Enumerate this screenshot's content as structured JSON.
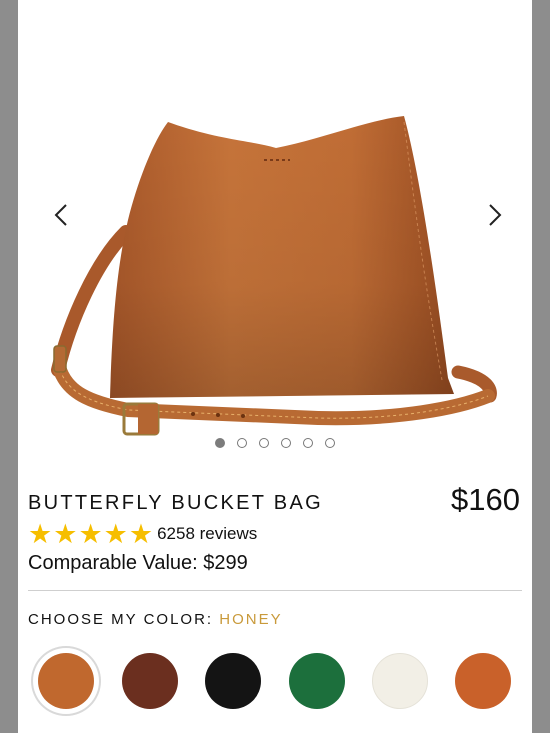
{
  "product": {
    "title": "BUTTERFLY BUCKET BAG",
    "price": "$160",
    "rating_stars": 5,
    "reviews": "6258 reviews",
    "comparable": "Comparable Value: $299"
  },
  "gallery": {
    "slide_count": 6,
    "active_slide": 1
  },
  "color_picker": {
    "label": "CHOOSE MY COLOR:",
    "selected": "HONEY",
    "selected_color": "#c99a3b",
    "swatches": [
      {
        "name": "honey",
        "color": "#c0682e"
      },
      {
        "name": "brown",
        "color": "#6b2f1f"
      },
      {
        "name": "black",
        "color": "#141414"
      },
      {
        "name": "green",
        "color": "#1c6f3c"
      },
      {
        "name": "cream",
        "color": "#f2efe6"
      },
      {
        "name": "tooled",
        "color": "#c9612a"
      }
    ]
  },
  "colors": {
    "star": "#f6be00",
    "accent": "#c99a3b"
  }
}
